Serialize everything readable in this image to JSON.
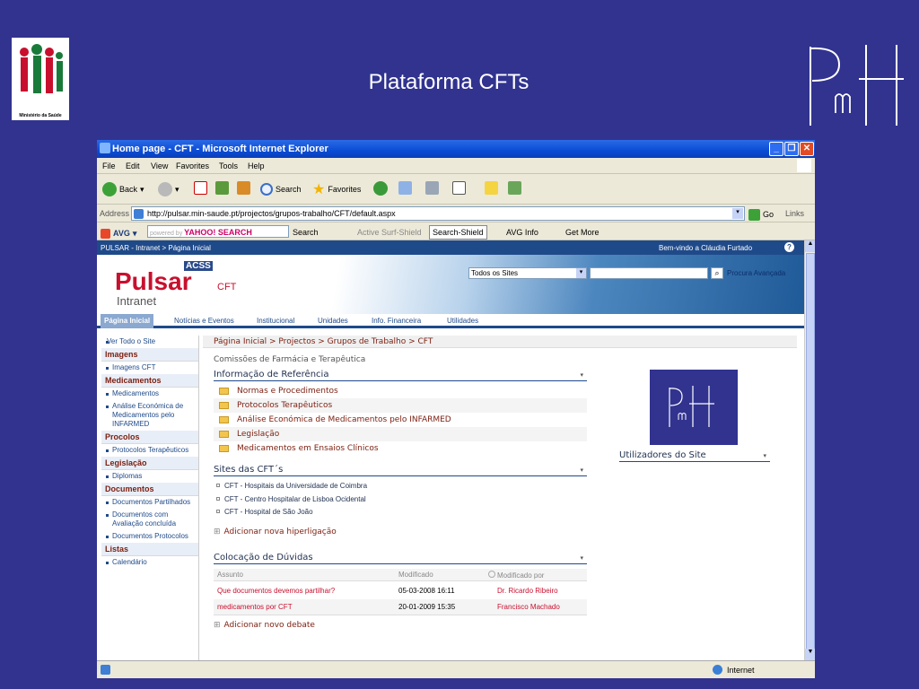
{
  "slide": {
    "title": "Plataforma CFTs",
    "left_logo_caption": "Ministério da Saúde",
    "right_logo_text": "PmH"
  },
  "window": {
    "title": "Home page - CFT - Microsoft Internet Explorer"
  },
  "menu": [
    "File",
    "Edit",
    "View",
    "Favorites",
    "Tools",
    "Help"
  ],
  "toolbar": {
    "back": "Back",
    "search": "Search",
    "favorites": "Favorites"
  },
  "address": {
    "label": "Address",
    "url": "http://pulsar.min-saude.pt/projectos/grupos-trabalho/CFT/default.aspx",
    "go": "Go",
    "links": "Links"
  },
  "avgbar": {
    "avg": "AVG",
    "powered": "powered by",
    "yahoo": "YAHOO! SEARCH",
    "search": "Search",
    "active_surf": "Active Surf-Shield",
    "search_shield": "Search-Shield",
    "avg_info": "AVG Info",
    "get_more": "Get More"
  },
  "sharepoint": {
    "breadcrumb_top": "PULSAR - Intranet > Página Inicial",
    "welcome": "Bem-vindo a Cláudia Furtado",
    "brand": "Pulsar",
    "brand_sub": "Intranet",
    "acss": "ACSS",
    "site_label": "CFT",
    "scope": "Todos os Sites",
    "advanced_search": "Procura Avançada",
    "nav": [
      "Página Inicial",
      "Notícias e Eventos",
      "Institucional",
      "Unidades",
      "Info. Financeira",
      "Utilidades"
    ]
  },
  "leftnav": {
    "view_all": "Ver Todo o Site",
    "sections": [
      {
        "head": "Imagens",
        "items": [
          "Imagens CFT"
        ]
      },
      {
        "head": "Medicamentos",
        "items": [
          "Medicamentos",
          "Análise Económica de Medicamentos pelo INFARMED"
        ]
      },
      {
        "head": "Procolos",
        "items": [
          "Protocolos Terapêuticos"
        ]
      },
      {
        "head": "Legislação",
        "items": [
          "Diplomas"
        ]
      },
      {
        "head": "Documentos",
        "items": [
          "Documentos Partilhados",
          "Documentos com Avaliação concluída",
          "Documentos Protocolos"
        ]
      },
      {
        "head": "Listas",
        "items": [
          "Calendário"
        ]
      }
    ]
  },
  "main": {
    "breadcrumb": "Página Inicial > Projectos > Grupos de Trabalho > CFT",
    "subtitle": "Comissões de Farmácia e Terapêutica",
    "ref_head": "Informação de Referência",
    "folders": [
      "Normas e Procedimentos",
      "Protocolos Terapêuticos",
      "Análise Económica de Medicamentos pelo INFARMED",
      "Legislação",
      "Medicamentos em Ensaios Clínicos"
    ],
    "sites_head": "Sites das CFT´s",
    "sites": [
      "CFT - Hospitais da Universidade de Coimbra",
      "CFT - Centro Hospitalar de Lisboa Ocidental",
      "CFT - Hospital de São João"
    ],
    "add_link": "Adicionar nova hiperligação",
    "users_head": "Utilizadores do Site",
    "doubts_head": "Colocação de Dúvidas",
    "table_headers": [
      "Assunto",
      "Modificado",
      "Modificado por"
    ],
    "table_rows": [
      [
        "Que documentos devemos partilhar?",
        "05-03-2008 16:11",
        "Dr. Ricardo Ribeiro"
      ],
      [
        "medicamentos por CFT",
        "20-01-2009 15:35",
        "Francisco Machado"
      ]
    ],
    "add_debate": "Adicionar novo debate"
  },
  "status": {
    "zone": "Internet"
  }
}
